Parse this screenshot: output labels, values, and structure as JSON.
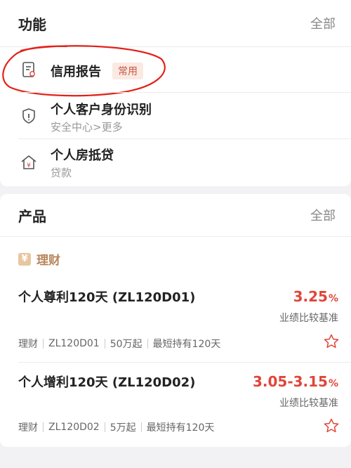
{
  "functions": {
    "title": "功能",
    "see_all": "全部",
    "items": [
      {
        "title": "信用报告",
        "badge": "常用",
        "icon": "report-document-icon"
      },
      {
        "title": "个人客户身份识别",
        "subtitle": "安全中心>更多",
        "icon": "shield-icon"
      },
      {
        "title": "个人房抵贷",
        "subtitle": "贷款",
        "icon": "house-yen-icon"
      }
    ]
  },
  "products": {
    "title": "产品",
    "see_all": "全部",
    "category": {
      "icon": "yen-icon",
      "icon_glyph": "¥",
      "label": "理财"
    },
    "items": [
      {
        "name": "个人尊利120天 (ZL120D01)",
        "rate": "3.25",
        "rate_unit": "%",
        "rate_label": "业绩比较基准",
        "tags": [
          "理财",
          "ZL120D01",
          "50万起",
          "最短持有120天"
        ]
      },
      {
        "name": "个人增利120天 (ZL120D02)",
        "rate": "3.05-3.15",
        "rate_unit": "%",
        "rate_label": "业绩比较基准",
        "tags": [
          "理财",
          "ZL120D02",
          "5万起",
          "最短持有120天"
        ]
      }
    ]
  },
  "colors": {
    "accent_red": "#e0463a",
    "badge_text": "#c9583e",
    "badge_bg": "#fbe9e4",
    "category_gold": "#b8865a",
    "annotation_red": "#e2231a"
  }
}
